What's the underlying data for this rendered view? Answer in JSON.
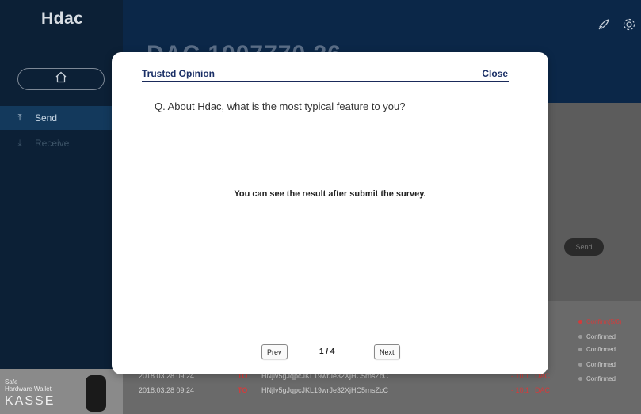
{
  "app": {
    "logo": "Hdac"
  },
  "sidebar": {
    "items": [
      {
        "label": "Send"
      },
      {
        "label": "Receive"
      }
    ]
  },
  "header": {
    "balance": "DAC 1007770.26"
  },
  "send_button_bg": "Send",
  "transactions": [
    {
      "date": "2018.03.28 09:24",
      "dir": "TO",
      "address": "HNjlv5gJqpcJKL19wrJe32XjHC5rnsZcC",
      "amount": "- 10.1",
      "currency": "DAC"
    },
    {
      "date": "2018.03.28 09:24",
      "dir": "TO",
      "address": "HNjlv5gJqpcJKL19wrJe32XjHC5rnsZcC",
      "amount": "- 10.1",
      "currency": "DAC"
    }
  ],
  "statuses": [
    "Confirm(5/6)",
    "Confirmed",
    "Confirmed",
    "Confirmed",
    "Confirmed"
  ],
  "ad": {
    "line1": "Safe",
    "line2": "Hardware Wallet",
    "brand": "KASSE"
  },
  "modal": {
    "title": "Trusted Opinion",
    "close_label": "Close",
    "question": "Q. About Hdac, what is the most typical feature to you?",
    "result_message": "You can see the result after submit the survey.",
    "prev_label": "Prev",
    "next_label": "Next",
    "page_indicator": "1 / 4"
  },
  "colors": {
    "sidebar": "#0c2036",
    "topbar": "#0b2748",
    "modal_accent": "#1a2f66",
    "debit": "#d43b3b"
  }
}
